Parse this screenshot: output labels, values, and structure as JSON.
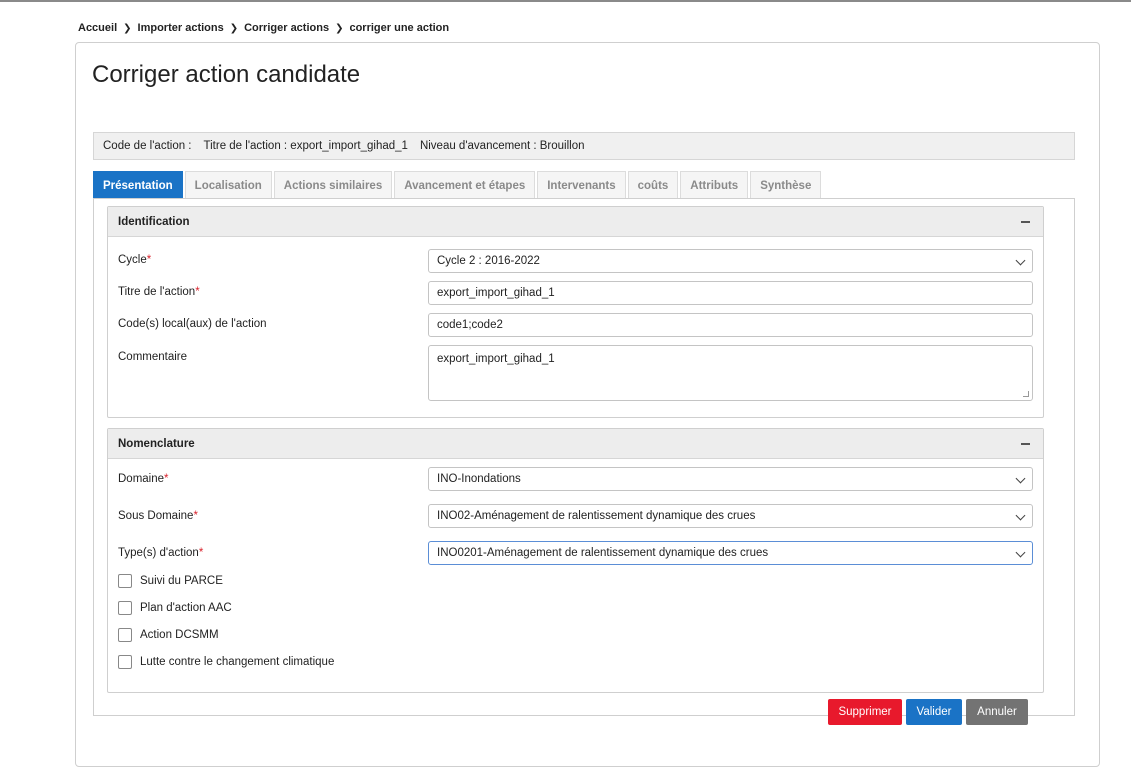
{
  "breadcrumb": {
    "items": [
      "Accueil",
      "Importer actions",
      "Corriger actions",
      "corriger une action"
    ]
  },
  "page": {
    "title": "Corriger action candidate"
  },
  "info": {
    "code": "Code de l'action :",
    "titre": "Titre de l'action : export_import_gihad_1",
    "niveau": "Niveau d'avancement : Brouillon"
  },
  "tabs": [
    {
      "label": "Présentation",
      "active": true
    },
    {
      "label": "Localisation"
    },
    {
      "label": "Actions similaires"
    },
    {
      "label": "Avancement et étapes"
    },
    {
      "label": "Intervenants"
    },
    {
      "label": "coûts"
    },
    {
      "label": "Attributs"
    },
    {
      "label": "Synthèse"
    }
  ],
  "identification": {
    "title": "Identification",
    "cycle_label": "Cycle",
    "cycle_value": "Cycle 2 : 2016-2022",
    "titre_label": "Titre de l'action",
    "titre_value": "export_import_gihad_1",
    "code_label": "Code(s) local(aux) de l'action",
    "code_value": "code1;code2",
    "commentaire_label": "Commentaire",
    "commentaire_value": "export_import_gihad_1"
  },
  "nomenclature": {
    "title": "Nomenclature",
    "domaine_label": "Domaine",
    "domaine_value": "INO-Inondations",
    "sous_domaine_label": "Sous Domaine",
    "sous_domaine_value": "INO02-Aménagement de ralentissement dynamique des crues",
    "type_label": "Type(s) d'action",
    "type_value": "INO0201-Aménagement de ralentissement dynamique des crues",
    "checkboxes": [
      {
        "label": "Suivi du PARCE",
        "checked": false
      },
      {
        "label": "Plan d'action AAC",
        "checked": false
      },
      {
        "label": "Action DCSMM",
        "checked": false
      },
      {
        "label": "Lutte contre le changement climatique",
        "checked": false
      }
    ]
  },
  "required_marker": "*",
  "buttons": {
    "supprimer": "Supprimer",
    "valider": "Valider",
    "annuler": "Annuler"
  },
  "colors": {
    "primary": "#1a73c6",
    "danger": "#e8192c",
    "default": "#737373",
    "required": "#d9232d"
  }
}
